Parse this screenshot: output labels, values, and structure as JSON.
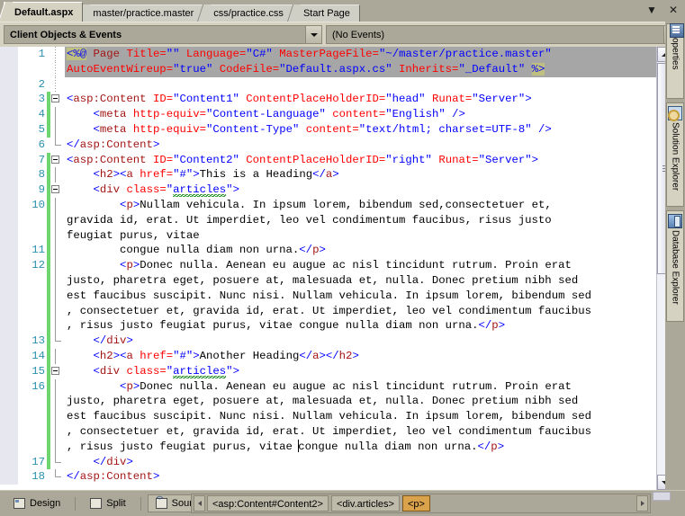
{
  "window": {
    "tabs": [
      {
        "label": "Default.aspx",
        "active": true
      },
      {
        "label": "master/practice.master",
        "active": false
      },
      {
        "label": "css/practice.css",
        "active": false
      },
      {
        "label": "Start Page",
        "active": false
      }
    ],
    "tab_list_button": "▼",
    "close_button": "✕"
  },
  "navbar": {
    "objects_value": "Client Objects & Events",
    "events_value": "(No Events)"
  },
  "dock_tabs": [
    {
      "label": "Properties",
      "icon": "properties-icon"
    },
    {
      "label": "Solution Explorer",
      "icon": "solution-explorer-icon"
    },
    {
      "label": "Database Explorer",
      "icon": "database-explorer-icon"
    }
  ],
  "editor": {
    "scrollbar": {
      "up": "▲",
      "down": "▼"
    },
    "lines": [
      {
        "number": "1",
        "selected": true,
        "segments": [
          {
            "t": "<%@",
            "c": "dir"
          },
          {
            "t": " ",
            "c": "text"
          },
          {
            "t": "Page",
            "c": "tag"
          },
          {
            "t": " ",
            "c": "text"
          },
          {
            "t": "Title=",
            "c": "attr"
          },
          {
            "t": "\"\"",
            "c": "val"
          },
          {
            "t": " ",
            "c": "text"
          },
          {
            "t": "Language=",
            "c": "attr"
          },
          {
            "t": "\"C#\"",
            "c": "val"
          },
          {
            "t": " ",
            "c": "text"
          },
          {
            "t": "MasterPageFile=",
            "c": "attr"
          },
          {
            "t": "\"~/master/practice.master\"",
            "c": "val"
          }
        ],
        "wrap": [
          {
            "selected": true,
            "segments": [
              {
                "t": "AutoEventWireup=",
                "c": "attr"
              },
              {
                "t": "\"true\"",
                "c": "val"
              },
              {
                "t": " ",
                "c": "text"
              },
              {
                "t": "CodeFile=",
                "c": "attr"
              },
              {
                "t": "\"Default.aspx.cs\"",
                "c": "val"
              },
              {
                "t": " ",
                "c": "text"
              },
              {
                "t": "Inherits=",
                "c": "attr"
              },
              {
                "t": "\"_Default\"",
                "c": "val"
              },
              {
                "t": " ",
                "c": "text"
              },
              {
                "t": "%>",
                "c": "dir"
              }
            ]
          }
        ]
      },
      {
        "number": "2",
        "selected": false,
        "segments": []
      },
      {
        "number": "3",
        "fold": "start",
        "changed": true,
        "segments": [
          {
            "t": "<",
            "c": "punc"
          },
          {
            "t": "asp:Content",
            "c": "tag"
          },
          {
            "t": " ",
            "c": "text"
          },
          {
            "t": "ID=",
            "c": "attr"
          },
          {
            "t": "\"Content1\"",
            "c": "val"
          },
          {
            "t": " ",
            "c": "text"
          },
          {
            "t": "ContentPlaceHolderID=",
            "c": "attr"
          },
          {
            "t": "\"head\"",
            "c": "val"
          },
          {
            "t": " ",
            "c": "text"
          },
          {
            "t": "Runat=",
            "c": "attr"
          },
          {
            "t": "\"Server\"",
            "c": "val"
          },
          {
            "t": ">",
            "c": "punc"
          }
        ]
      },
      {
        "number": "4",
        "fold": "mid",
        "changed": true,
        "segments": [
          {
            "t": "    ",
            "c": "text"
          },
          {
            "t": "<",
            "c": "punc"
          },
          {
            "t": "meta",
            "c": "tag"
          },
          {
            "t": " ",
            "c": "text"
          },
          {
            "t": "http-equiv=",
            "c": "attr"
          },
          {
            "t": "\"Content-Language\"",
            "c": "val"
          },
          {
            "t": " ",
            "c": "text"
          },
          {
            "t": "content=",
            "c": "attr"
          },
          {
            "t": "\"English\"",
            "c": "val"
          },
          {
            "t": " />",
            "c": "punc"
          }
        ]
      },
      {
        "number": "5",
        "fold": "mid",
        "changed": true,
        "segments": [
          {
            "t": "    ",
            "c": "text"
          },
          {
            "t": "<",
            "c": "punc"
          },
          {
            "t": "meta",
            "c": "tag"
          },
          {
            "t": " ",
            "c": "text"
          },
          {
            "t": "http-equiv=",
            "c": "attr"
          },
          {
            "t": "\"Content-Type\"",
            "c": "val"
          },
          {
            "t": " ",
            "c": "text"
          },
          {
            "t": "content=",
            "c": "attr"
          },
          {
            "t": "\"text/html; charset=UTF-8\"",
            "c": "val"
          },
          {
            "t": " />",
            "c": "punc"
          }
        ]
      },
      {
        "number": "6",
        "fold": "end",
        "segments": [
          {
            "t": "</",
            "c": "punc"
          },
          {
            "t": "asp:Content",
            "c": "tag"
          },
          {
            "t": ">",
            "c": "punc"
          }
        ]
      },
      {
        "number": "7",
        "fold": "start",
        "changed": true,
        "segments": [
          {
            "t": "<",
            "c": "punc"
          },
          {
            "t": "asp:Content",
            "c": "tag"
          },
          {
            "t": " ",
            "c": "text"
          },
          {
            "t": "ID=",
            "c": "attr"
          },
          {
            "t": "\"Content2\"",
            "c": "val"
          },
          {
            "t": " ",
            "c": "text"
          },
          {
            "t": "ContentPlaceHolderID=",
            "c": "attr"
          },
          {
            "t": "\"right\"",
            "c": "val"
          },
          {
            "t": " ",
            "c": "text"
          },
          {
            "t": "Runat=",
            "c": "attr"
          },
          {
            "t": "\"Server\"",
            "c": "val"
          },
          {
            "t": ">",
            "c": "punc"
          }
        ]
      },
      {
        "number": "8",
        "fold": "mid",
        "changed": true,
        "segments": [
          {
            "t": "    ",
            "c": "text"
          },
          {
            "t": "<",
            "c": "punc"
          },
          {
            "t": "h2",
            "c": "tag"
          },
          {
            "t": "><",
            "c": "punc"
          },
          {
            "t": "a",
            "c": "tag"
          },
          {
            "t": " ",
            "c": "text"
          },
          {
            "t": "href=",
            "c": "attr"
          },
          {
            "t": "\"#\"",
            "c": "val"
          },
          {
            "t": ">",
            "c": "punc"
          },
          {
            "t": "This is a Heading",
            "c": "text"
          },
          {
            "t": "</",
            "c": "punc"
          },
          {
            "t": "a",
            "c": "tag"
          },
          {
            "t": ">",
            "c": "punc"
          }
        ]
      },
      {
        "number": "9",
        "fold": "start",
        "changed": true,
        "segments": [
          {
            "t": "    ",
            "c": "text"
          },
          {
            "t": "<",
            "c": "punc"
          },
          {
            "t": "div",
            "c": "tag"
          },
          {
            "t": " ",
            "c": "text"
          },
          {
            "t": "class=",
            "c": "attr"
          },
          {
            "t": "\"",
            "c": "val"
          },
          {
            "t": "articles",
            "c": "val squig"
          },
          {
            "t": "\"",
            "c": "val"
          },
          {
            "t": ">",
            "c": "punc"
          }
        ]
      },
      {
        "number": "10",
        "fold": "mid",
        "changed": true,
        "segments": [
          {
            "t": "        ",
            "c": "text"
          },
          {
            "t": "<",
            "c": "punc"
          },
          {
            "t": "p",
            "c": "tag"
          },
          {
            "t": ">",
            "c": "punc"
          },
          {
            "t": "Nullam vehicula. In ipsum lorem, bibendum sed,consectetuer et,",
            "c": "text"
          }
        ],
        "wrap": [
          {
            "segments": [
              {
                "t": "gravida id, erat. Ut imperdiet, leo vel condimentum faucibus, risus justo",
                "c": "text"
              }
            ]
          },
          {
            "segments": [
              {
                "t": "feugiat purus, vitae",
                "c": "text"
              }
            ]
          }
        ]
      },
      {
        "number": "11",
        "fold": "mid",
        "changed": true,
        "segments": [
          {
            "t": "        ",
            "c": "text"
          },
          {
            "t": "congue nulla diam non urna.",
            "c": "text"
          },
          {
            "t": "</",
            "c": "punc"
          },
          {
            "t": "p",
            "c": "tag"
          },
          {
            "t": ">",
            "c": "punc"
          }
        ]
      },
      {
        "number": "12",
        "fold": "mid",
        "changed": true,
        "segments": [
          {
            "t": "        ",
            "c": "text"
          },
          {
            "t": "<",
            "c": "punc"
          },
          {
            "t": "p",
            "c": "tag"
          },
          {
            "t": ">",
            "c": "punc"
          },
          {
            "t": "Donec nulla. Aenean eu augue ac nisl tincidunt rutrum. Proin erat",
            "c": "text"
          }
        ],
        "wrap": [
          {
            "segments": [
              {
                "t": "justo, pharetra eget, posuere at, malesuada et, nulla. Donec pretium nibh sed",
                "c": "text"
              }
            ]
          },
          {
            "segments": [
              {
                "t": "est faucibus suscipit. Nunc nisi. Nullam vehicula. In ipsum lorem, bibendum sed",
                "c": "text"
              }
            ]
          },
          {
            "segments": [
              {
                "t": ", consectetuer et, gravida id, erat. Ut imperdiet, leo vel condimentum faucibus",
                "c": "text"
              }
            ]
          },
          {
            "segments": [
              {
                "t": ", risus justo feugiat purus, vitae congue nulla diam non urna.",
                "c": "text"
              },
              {
                "t": "</",
                "c": "punc"
              },
              {
                "t": "p",
                "c": "tag"
              },
              {
                "t": ">",
                "c": "punc"
              }
            ]
          }
        ]
      },
      {
        "number": "13",
        "fold": "end",
        "changed": true,
        "segments": [
          {
            "t": "    ",
            "c": "text"
          },
          {
            "t": "</",
            "c": "punc"
          },
          {
            "t": "div",
            "c": "tag"
          },
          {
            "t": ">",
            "c": "punc"
          }
        ]
      },
      {
        "number": "14",
        "fold": "mid",
        "changed": true,
        "segments": [
          {
            "t": "    ",
            "c": "text"
          },
          {
            "t": "<",
            "c": "punc"
          },
          {
            "t": "h2",
            "c": "tag"
          },
          {
            "t": "><",
            "c": "punc"
          },
          {
            "t": "a",
            "c": "tag"
          },
          {
            "t": " ",
            "c": "text"
          },
          {
            "t": "href=",
            "c": "attr"
          },
          {
            "t": "\"#\"",
            "c": "val"
          },
          {
            "t": ">",
            "c": "punc"
          },
          {
            "t": "Another Heading",
            "c": "text"
          },
          {
            "t": "</",
            "c": "punc"
          },
          {
            "t": "a",
            "c": "tag"
          },
          {
            "t": "></",
            "c": "punc"
          },
          {
            "t": "h2",
            "c": "tag"
          },
          {
            "t": ">",
            "c": "punc"
          }
        ]
      },
      {
        "number": "15",
        "fold": "start",
        "changed": true,
        "segments": [
          {
            "t": "    ",
            "c": "text"
          },
          {
            "t": "<",
            "c": "punc"
          },
          {
            "t": "div",
            "c": "tag"
          },
          {
            "t": " ",
            "c": "text"
          },
          {
            "t": "class=",
            "c": "attr"
          },
          {
            "t": "\"",
            "c": "val"
          },
          {
            "t": "articles",
            "c": "val squig"
          },
          {
            "t": "\"",
            "c": "val"
          },
          {
            "t": ">",
            "c": "punc"
          }
        ]
      },
      {
        "number": "16",
        "fold": "mid",
        "changed": true,
        "segments": [
          {
            "t": "        ",
            "c": "text"
          },
          {
            "t": "<",
            "c": "punc"
          },
          {
            "t": "p",
            "c": "tag"
          },
          {
            "t": ">",
            "c": "punc"
          },
          {
            "t": "Donec nulla. Aenean eu augue ac nisl tincidunt rutrum. Proin erat",
            "c": "text"
          }
        ],
        "wrap": [
          {
            "segments": [
              {
                "t": "justo, pharetra eget, posuere at, malesuada et, nulla. Donec pretium nibh sed",
                "c": "text"
              }
            ]
          },
          {
            "segments": [
              {
                "t": "est faucibus suscipit. Nunc nisi. Nullam vehicula. In ipsum lorem, bibendum sed",
                "c": "text"
              }
            ]
          },
          {
            "segments": [
              {
                "t": ", consectetuer et, gravida id, erat. Ut imperdiet, leo vel condimentum faucibus",
                "c": "text"
              }
            ]
          },
          {
            "caret_before": "congue",
            "segments": [
              {
                "t": ", risus justo feugiat purus, vitae ",
                "c": "text"
              },
              {
                "t": "caret",
                "c": "caret"
              },
              {
                "t": "congue nulla diam non urna.",
                "c": "text"
              },
              {
                "t": "</",
                "c": "punc"
              },
              {
                "t": "p",
                "c": "tag"
              },
              {
                "t": ">",
                "c": "punc"
              }
            ]
          }
        ]
      },
      {
        "number": "17",
        "fold": "end",
        "changed": true,
        "segments": [
          {
            "t": "    ",
            "c": "text"
          },
          {
            "t": "</",
            "c": "punc"
          },
          {
            "t": "div",
            "c": "tag"
          },
          {
            "t": ">",
            "c": "punc"
          }
        ]
      },
      {
        "number": "18",
        "fold": "end",
        "segments": [
          {
            "t": "</",
            "c": "punc"
          },
          {
            "t": "asp:Content",
            "c": "tag"
          },
          {
            "t": ">",
            "c": "punc"
          }
        ]
      }
    ]
  },
  "bottom": {
    "view_buttons": [
      {
        "label": "Design",
        "icon": "design-view-icon",
        "active": false
      },
      {
        "label": "Split",
        "icon": "split-view-icon",
        "active": false
      },
      {
        "label": "Source",
        "icon": "source-view-icon",
        "active": true
      }
    ],
    "breadcrumbs": [
      {
        "label": "<asp:Content#Content2>",
        "selected": false
      },
      {
        "label": "<div.articles>",
        "selected": false
      },
      {
        "label": "<p>",
        "selected": true
      }
    ],
    "nav_left": "◀",
    "nav_right": "▶"
  },
  "colors": {
    "chrome": "#ACA899",
    "panel": "#D6D2C2",
    "tag": "#A31515",
    "attribute": "#FF0000",
    "value": "#0000FF",
    "line_number": "#2B91AF",
    "change_bar": "#6FD66F",
    "selection": "#A6A6A6",
    "directive_highlight": "#BFBF7F",
    "breadcrumb_selected": "#D9A24B",
    "squiggle": "#008000"
  }
}
